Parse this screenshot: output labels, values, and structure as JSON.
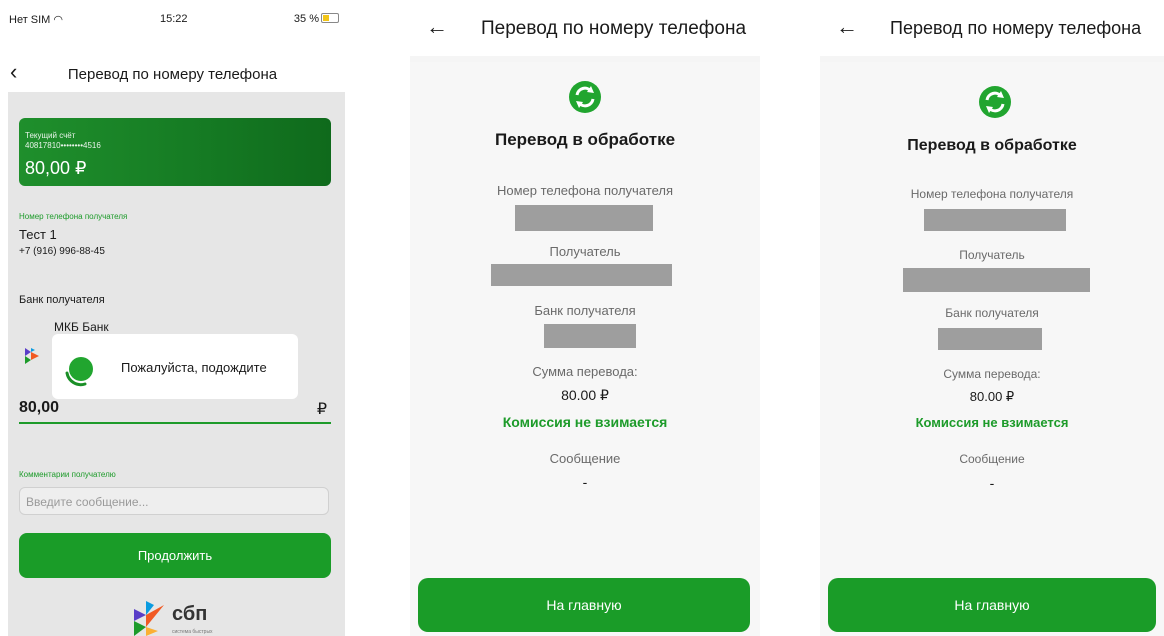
{
  "screen1": {
    "status_bar": {
      "carrier": "Нет SIM",
      "time": "15:22",
      "battery": "35 %"
    },
    "nav": {
      "title": "Перевод по номеру телефона"
    },
    "account": {
      "type": "Текущий счёт",
      "number": "40817810••••••••4516",
      "balance": "80,00 ₽"
    },
    "recipient": {
      "label": "Номер телефона получателя",
      "name": "Тест 1",
      "phone": "+7 (916) 996-88-45"
    },
    "bank": {
      "label": "Банк получателя",
      "name": "МКБ Банк"
    },
    "modal": {
      "text": "Пожалуйста, подождите"
    },
    "amount": {
      "value": "80,00",
      "currency": "₽"
    },
    "comment": {
      "label": "Комментарии получателю",
      "placeholder": "Введите сообщение..."
    },
    "continue_label": "Продолжить",
    "sbp": {
      "text": "сбп",
      "subtext": "система быстрых"
    },
    "colors": {
      "accent": "#1a9c28",
      "card": "#157a23"
    }
  },
  "screen2": {
    "title": "Перевод по номеру телефона",
    "status_title": "Перевод в обработке",
    "phone_label": "Номер телефона получателя",
    "recipient_label": "Получатель",
    "bank_label": "Банк получателя",
    "amount_label": "Сумма перевода:",
    "amount": "80.00 ₽",
    "fee": "Комиссия не взимается",
    "message_label": "Сообщение",
    "message": "-",
    "home_button": "На главную"
  },
  "screen3": {
    "title": "Перевод по номеру телефона",
    "status_title": "Перевод в обработке",
    "phone_label": "Номер телефона получателя",
    "recipient_label": "Получатель",
    "bank_label": "Банк получателя",
    "amount_label": "Сумма перевода:",
    "amount": "80.00 ₽",
    "fee": "Комиссия не взимается",
    "message_label": "Сообщение",
    "message": "-",
    "home_button": "На главную"
  }
}
